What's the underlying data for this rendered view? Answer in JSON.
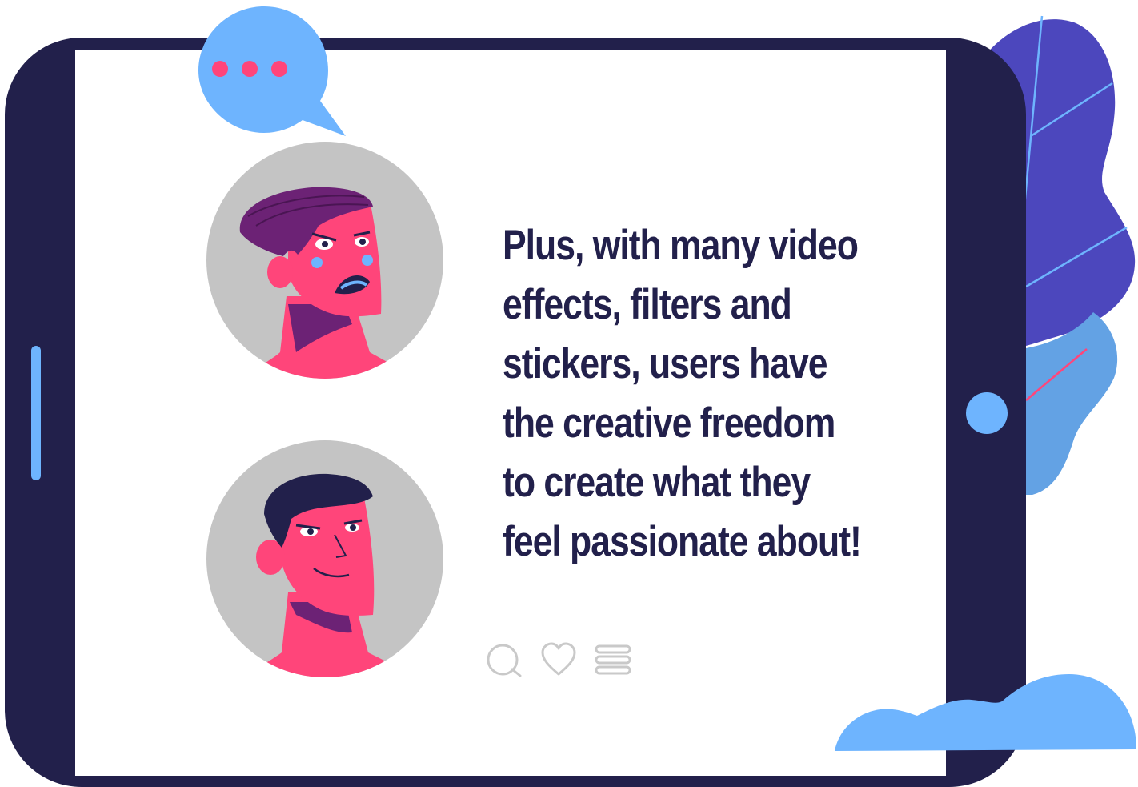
{
  "post": {
    "text": "Plus, with many video\neffects, filters and\nstickers, users have\nthe creative freedom\nto create what they\nfeel passionate about!"
  },
  "actions": [
    {
      "icon": "comment-icon"
    },
    {
      "icon": "heart-icon"
    },
    {
      "icon": "menu-icon"
    }
  ],
  "colors": {
    "device_frame": "#22204b",
    "screen": "#ffffff",
    "text": "#22204b",
    "accent_blue": "#6eb4fe",
    "accent_pink": "#ff457a",
    "accent_purple": "#4c47bd",
    "hair_purple": "#6c2275",
    "avatar_background": "#c4c4c4",
    "icon_grey": "#c9c9c9"
  }
}
